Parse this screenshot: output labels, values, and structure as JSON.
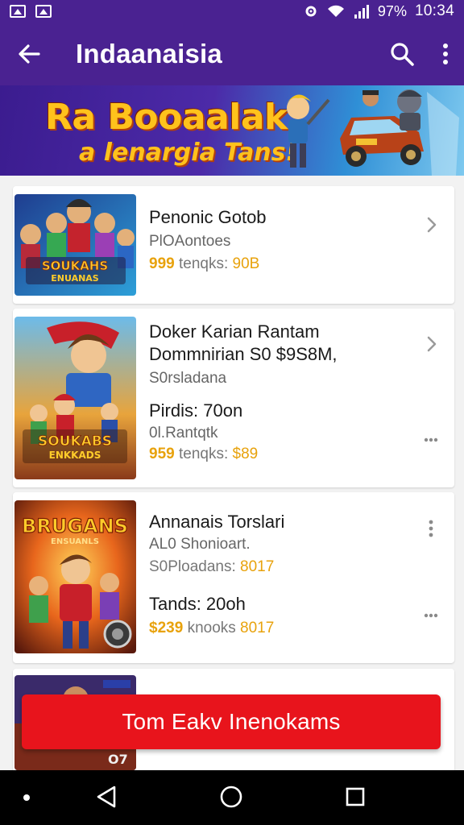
{
  "status_bar": {
    "battery_text": "97%",
    "time": "10:34",
    "icons": [
      "image-icon",
      "gallery-icon",
      "settings-icon",
      "wifi-icon",
      "signal-icon"
    ]
  },
  "app_bar": {
    "title": "Indaanaisia",
    "color": "#4a2291",
    "icons": [
      "back-arrow-icon",
      "search-icon",
      "more-vert-icon"
    ]
  },
  "banner": {
    "title": "Ra Booaalak",
    "subtitle": "a lenargia Tans!"
  },
  "items": [
    {
      "title": "Penonic Gotob",
      "line2": "PlOAontoes",
      "price_amount": "999",
      "price_text": "tenqks:",
      "price_tail": "90B",
      "thumb_caption": "SOUKAHS",
      "thumb_caption2": "ENUANAS",
      "action": "chevron-right-icon"
    },
    {
      "title": "Doker Karian Rantam",
      "line2": "Dommnirian  S0 $9S8M,",
      "line3": "S0rsladana",
      "line4": "Pirdis: 70on",
      "line5": "0l.Rantqtk",
      "price_amount": "959",
      "price_text": "tenqks:",
      "price_tail": "$89",
      "thumb_caption": "SOUKABS",
      "thumb_caption2": "ENKKADS",
      "actions": [
        "chevron-right-icon",
        "more-horiz-icon"
      ]
    },
    {
      "title": "Annanais Torslari",
      "line2": "AL0 Shonioart.",
      "line3_text": "S0Ploadans:",
      "line3_tail": "8017",
      "line4": "Tands: 20oh",
      "price_amount": "$239",
      "price_text": "knooks",
      "price_tail": "8017",
      "thumb_caption": "BRUGANS",
      "thumb_caption2": "ENSUANLS",
      "actions": [
        "more-vert-icon",
        "more-horiz-icon"
      ]
    },
    {
      "title": "",
      "thumb_caption": "O7"
    }
  ],
  "install_button": {
    "label": "Tom Eakv Inenokams",
    "color": "#e8141c"
  },
  "nav_bar": {
    "icons": [
      "nav-dot-icon",
      "nav-back-icon",
      "nav-home-icon",
      "nav-recents-icon"
    ]
  }
}
